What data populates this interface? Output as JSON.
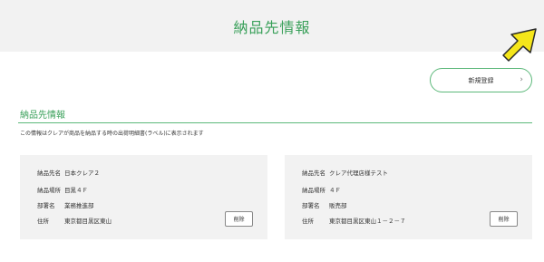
{
  "header": {
    "title": "納品先情報"
  },
  "actions": {
    "new_label": "新規登録",
    "new_chevron": "›"
  },
  "section": {
    "heading": "納品先情報",
    "description": "この情報はクレアが商品を納品する時の出荷明細書(ラベル)に表示されます"
  },
  "labels": {
    "name": "納品先名",
    "place": "納品場所",
    "dept": "部署名",
    "address": "住所"
  },
  "cards": [
    {
      "name": "日本クレア２",
      "place": "目黒４Ｆ",
      "dept": "業務推進部",
      "address": "東京都目黒区東山",
      "delete_label": "削除"
    },
    {
      "name": "クレア代理店様テスト",
      "place": "４Ｆ",
      "dept": "販売部",
      "address": "東京都目黒区東山１－２－７",
      "delete_label": "削除"
    }
  ],
  "colors": {
    "accent": "#3aa05a",
    "marker": "#f5e61a"
  }
}
